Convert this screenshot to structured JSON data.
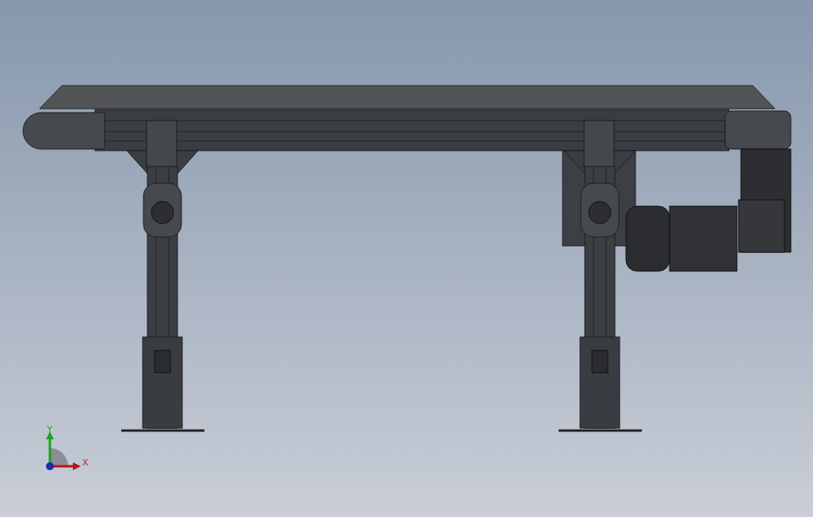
{
  "triad": {
    "y_label": "Y",
    "x_label": "X"
  }
}
